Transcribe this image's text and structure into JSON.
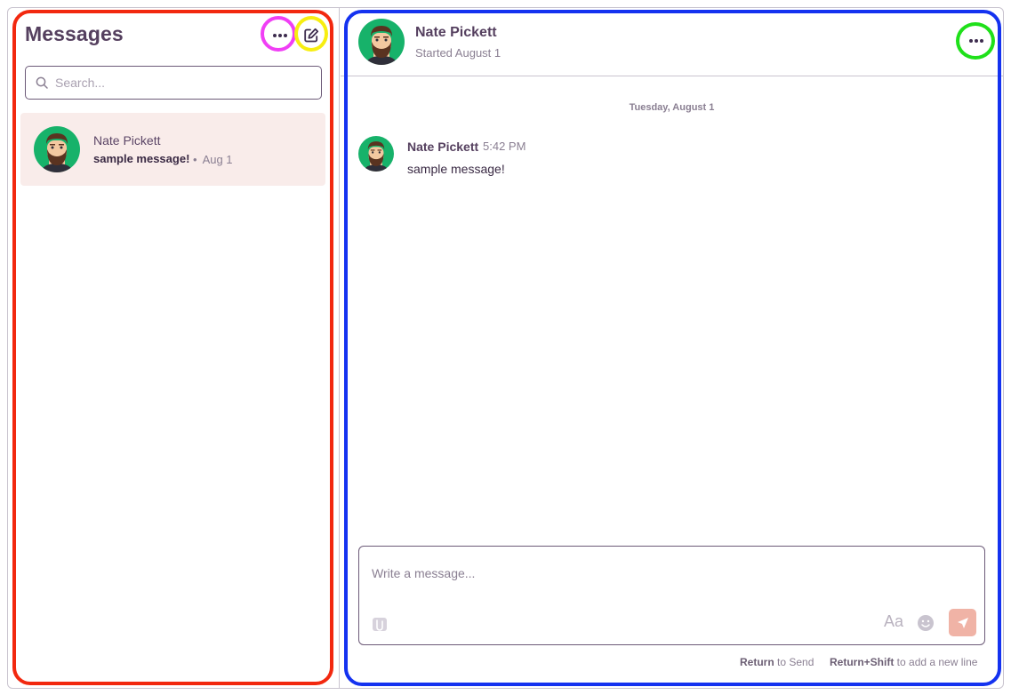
{
  "sidebar": {
    "title": "Messages",
    "search_placeholder": "Search...",
    "conversations": [
      {
        "name": "Nate Pickett",
        "snippet": "sample message!",
        "date": "Aug 1"
      }
    ]
  },
  "chat": {
    "name": "Nate Pickett",
    "subtitle": "Started August 1",
    "day_separator": "Tuesday, August 1",
    "messages": [
      {
        "sender": "Nate Pickett",
        "time": "5:42 PM",
        "text": "sample message!"
      }
    ],
    "composer": {
      "placeholder": "Write a message...",
      "format_label": "Aa"
    },
    "hints": {
      "send_key": "Return",
      "send_text": " to Send",
      "newline_key": "Return+Shift",
      "newline_text": " to add a new line"
    }
  },
  "colors": {
    "accent_send": "#f0b3a6",
    "selected_conversation": "#f9ecea",
    "avatar_bg": "#17b26a",
    "annotation_red": "#f2280f",
    "annotation_blue": "#1432f0",
    "annotation_magenta": "#f03ff5",
    "annotation_yellow": "#f7ee10",
    "annotation_green": "#1fe01a"
  },
  "icons": [
    "more-horizontal-icon",
    "compose-icon",
    "search-icon",
    "attachment-icon",
    "emoji-icon",
    "send-icon"
  ]
}
